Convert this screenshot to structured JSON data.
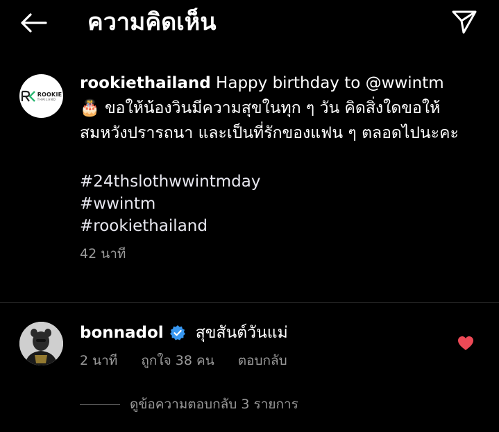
{
  "header": {
    "title": "ความคิดเห็น",
    "back_icon": "arrow-left-icon",
    "send_icon": "paper-plane-icon"
  },
  "caption": {
    "username": "rookiethailand",
    "first_line": " Happy birthday to @wwintm",
    "text": "🎂 ขอให้น้องวินมีความสุขในทุก ๆ วัน คิดสิ่งใดขอให้สมหวังปรารถนา และเป็นที่รักของแฟน ๆ ตลอดไปนะคะ",
    "hashtags": [
      "#24thslothwwintmday",
      "#wwintm",
      "#rookiethailand"
    ],
    "time": "42 นาที",
    "avatar_logo_word": "ROOKIE",
    "avatar_logo_sub": "THAILAND"
  },
  "comment": {
    "username": "bonnadol",
    "text": "สุขสันต์วันแม่",
    "time": "2 นาที",
    "likes": "ถูกใจ 38 คน",
    "reply": "ตอบกลับ",
    "liked": true,
    "heart_color": "#ed4956",
    "verified_color": "#3897f0"
  },
  "view_replies": "ดูข้อความตอบกลับ 3 รายการ"
}
